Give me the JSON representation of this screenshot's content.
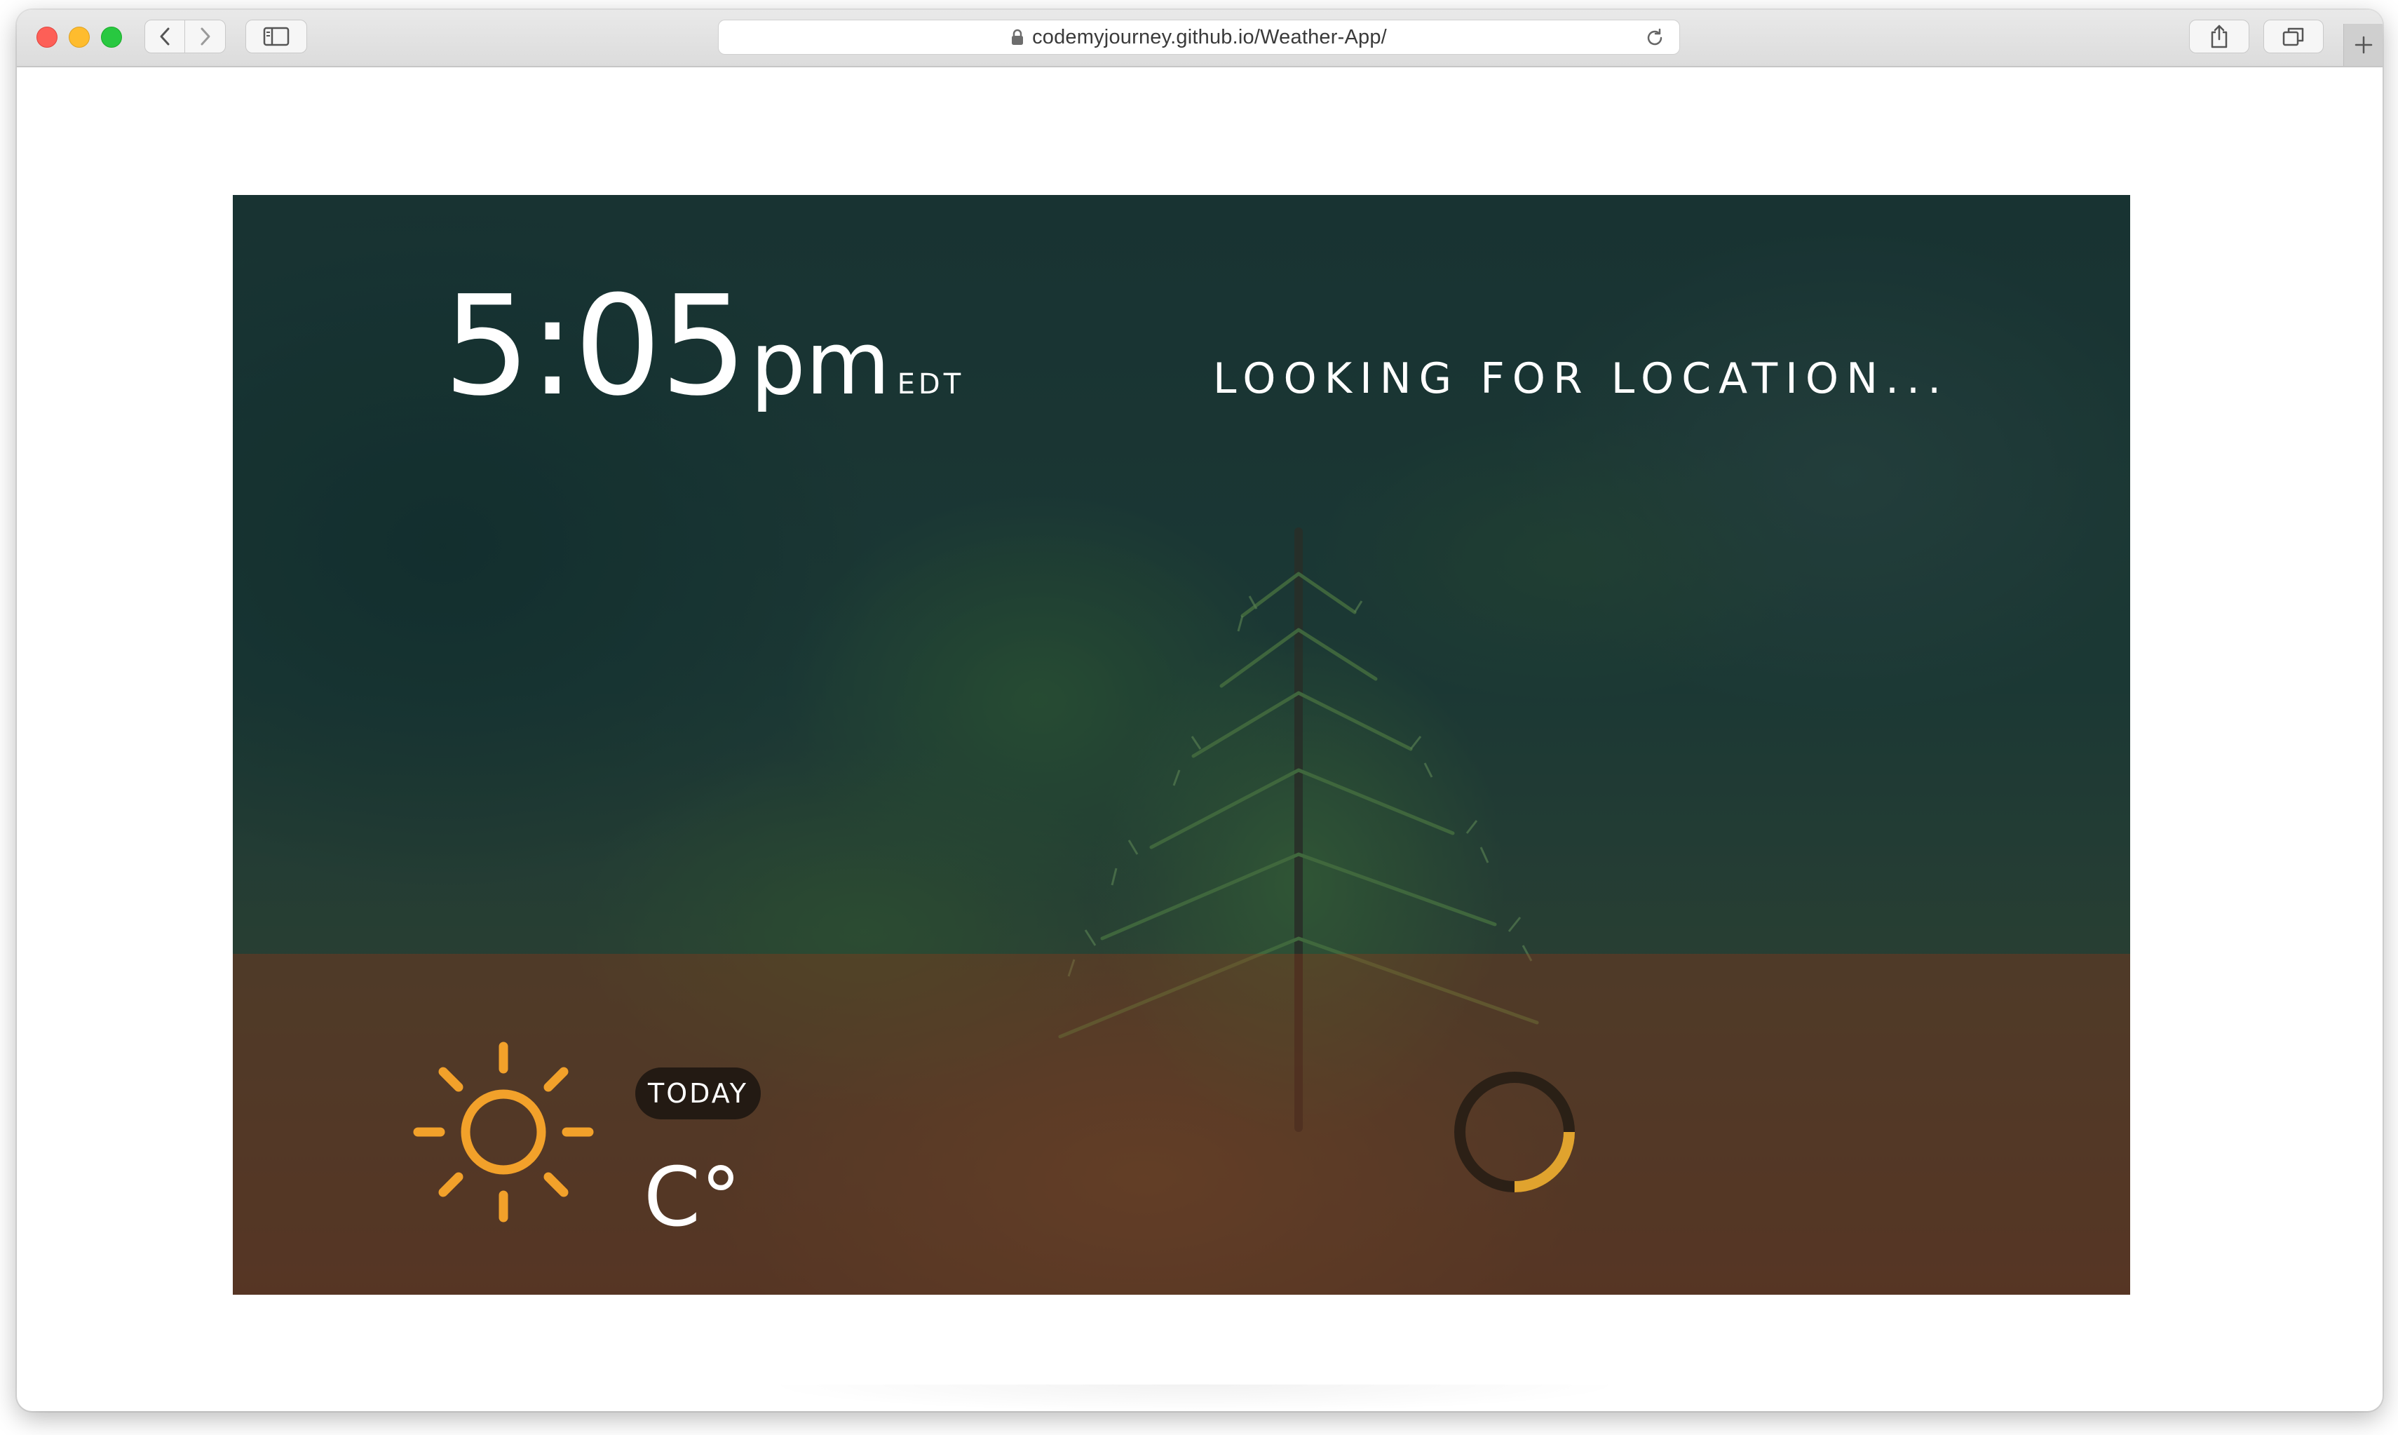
{
  "browser": {
    "url": "codemyjourney.github.io/Weather-App/"
  },
  "app": {
    "time": "5:05",
    "ampm": "pm",
    "timezone": "EDT",
    "location": "LOOKING FOR LOCATION...",
    "day_label": "TODAY",
    "temperature": "C°"
  },
  "icons": {
    "weather": "sun-icon",
    "loading": "loading-spinner"
  },
  "colors": {
    "sun": "#f2a12a",
    "spinner": "#e0a32e",
    "top_overlay": "#123030",
    "bottom_overlay": "#5c3220"
  }
}
